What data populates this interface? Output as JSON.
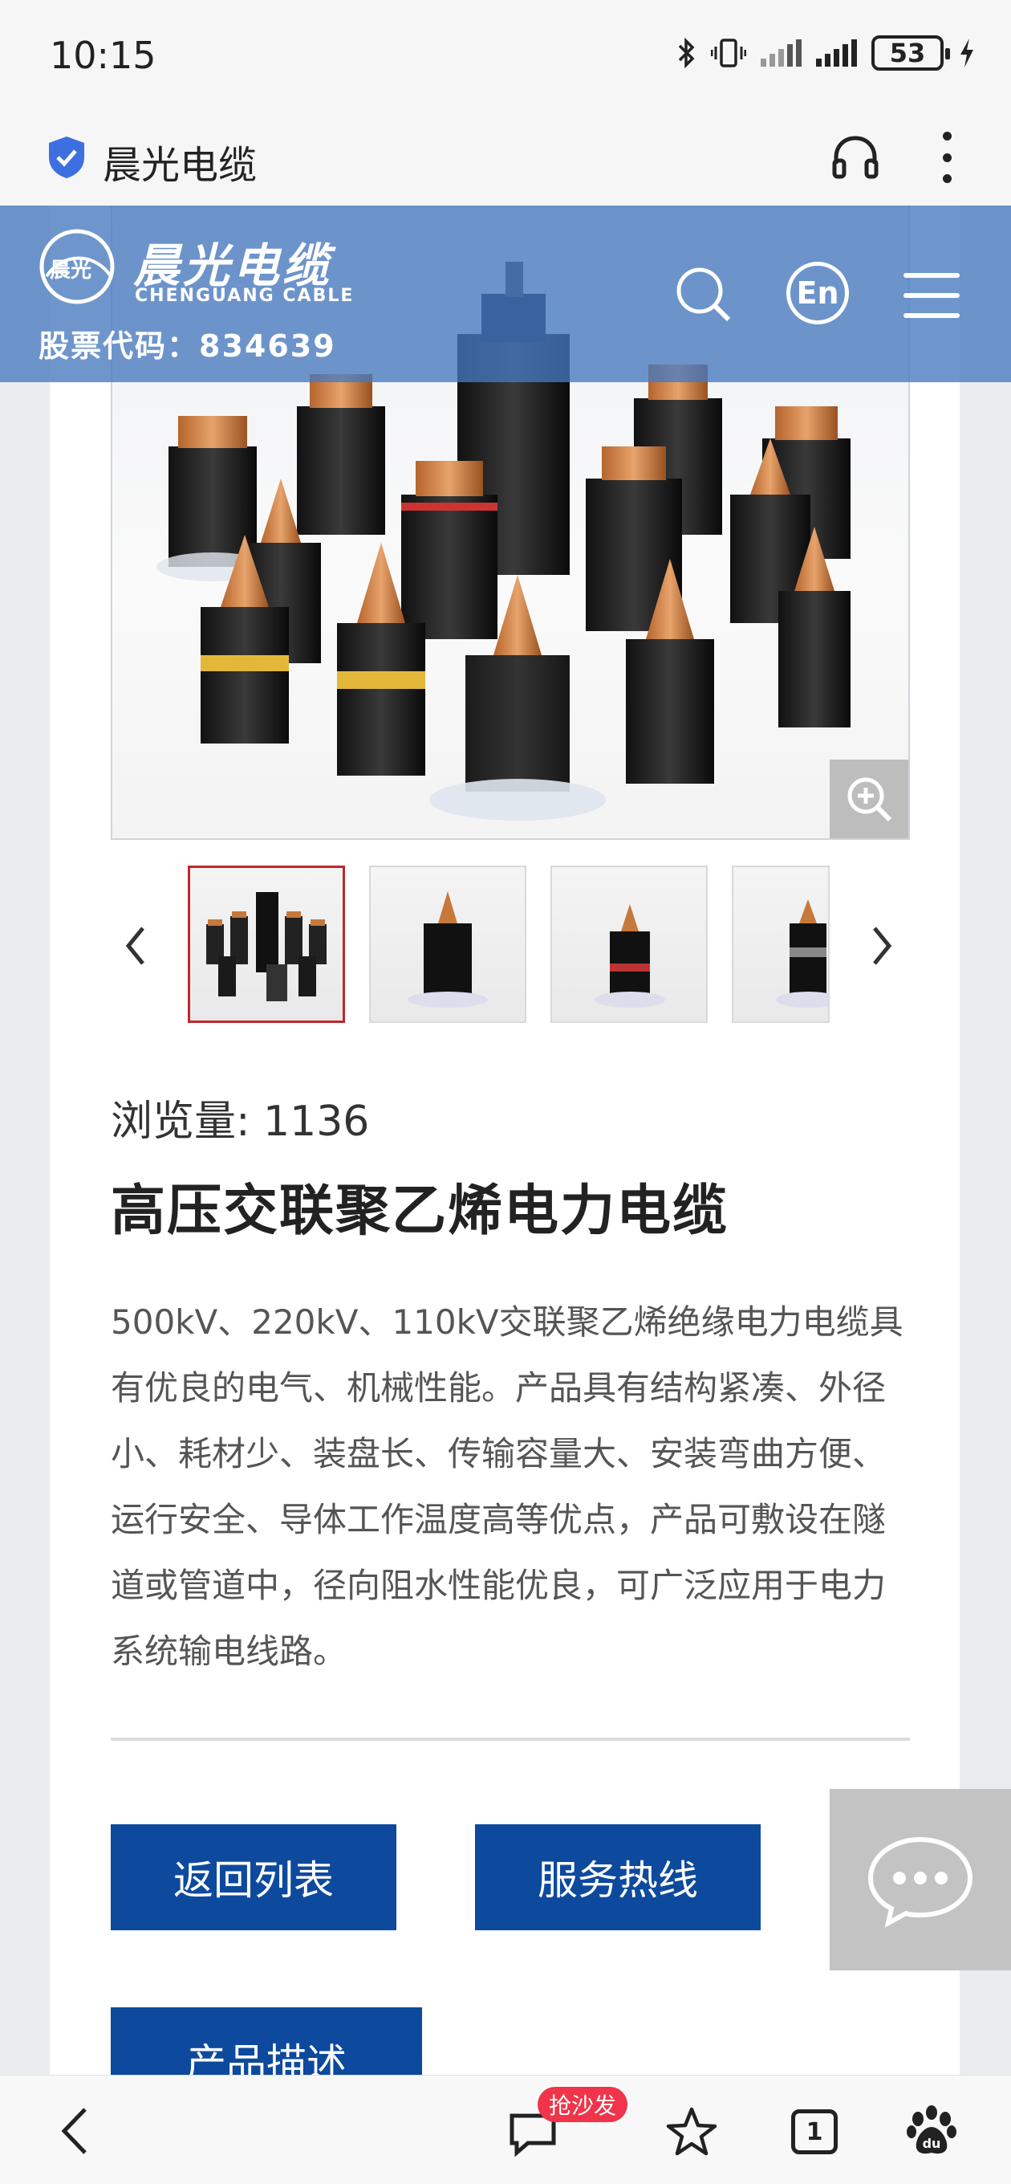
{
  "status_bar": {
    "time": "10:15",
    "battery": "53",
    "icons": [
      "bluetooth-icon",
      "vibrate-icon",
      "signal-icon",
      "signal-icon",
      "charging-icon"
    ]
  },
  "browser": {
    "site_name": "晨光电缆",
    "icons": [
      "shield-icon",
      "headphone-icon",
      "more-icon"
    ]
  },
  "site_header": {
    "logo_mark_text": "晨光",
    "logo_cn": "晨光电缆",
    "logo_en": "CHENGUANG CABLE",
    "stock_code": "股票代码：834639",
    "lang_button": "En"
  },
  "product": {
    "views_label": "浏览量: 1136",
    "title": "高压交联聚乙烯电力电缆",
    "description": "500kV、220kV、110kV交联聚乙烯绝缘电力电缆具有优良的电气、机械性能。产品具有结构紧凑、外径小、耗材少、装盘长、传输容量大、安装弯曲方便、运行安全、导体工作温度高等优点，产品可敷设在隧道或管道中，径向阻水性能优良，可广泛应用于电力系统输电线路。",
    "thumbnails_count": 4,
    "active_thumbnail": 0
  },
  "buttons": {
    "back_to_list": "返回列表",
    "service_hotline": "服务热线",
    "product_description": "产品描述"
  },
  "bottom_nav": {
    "comment_badge": "抢沙发",
    "tab_count": "1"
  },
  "colors": {
    "primary_blue": "#0d4a9e",
    "header_overlay": "#4678be",
    "active_thumb_border": "#c0272d",
    "badge_red": "#f0344a"
  }
}
